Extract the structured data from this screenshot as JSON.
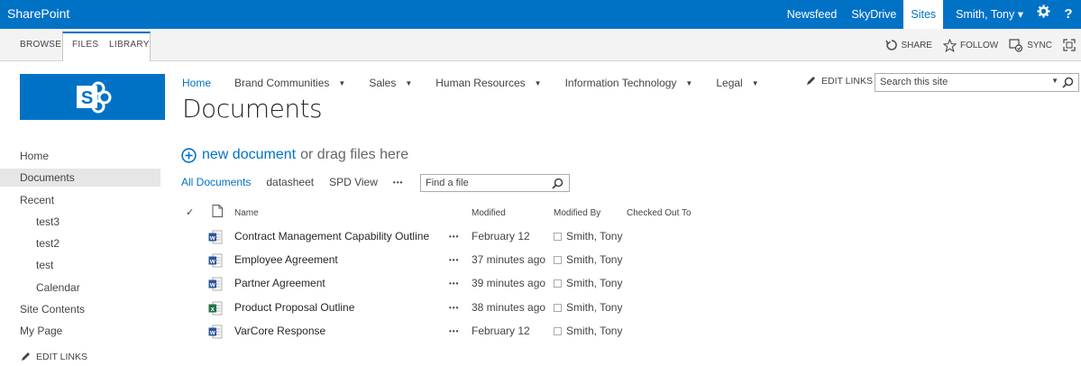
{
  "suite": {
    "brand": "SharePoint",
    "links": [
      "Newsfeed",
      "SkyDrive",
      "Sites"
    ],
    "active_link": "Sites",
    "user": "Smith, Tony ▾",
    "icons": [
      "gear-icon",
      "help-icon"
    ],
    "help_glyph": "?"
  },
  "ribbon": {
    "tabs": [
      "BROWSE",
      "FILES",
      "LIBRARY"
    ],
    "actions": {
      "share": "SHARE",
      "follow": "FOLLOW",
      "sync": "SYNC"
    }
  },
  "site": {
    "logo_letter": "S",
    "topnav": [
      {
        "label": "Home",
        "current": true
      },
      {
        "label": "Brand Communities",
        "dropdown": true
      },
      {
        "label": "Sales",
        "dropdown": true
      },
      {
        "label": "Human Resources",
        "dropdown": true
      },
      {
        "label": "Information Technology",
        "dropdown": true
      },
      {
        "label": "Legal",
        "dropdown": true
      }
    ],
    "edit_links": "EDIT LINKS",
    "search_placeholder": "Search this site",
    "page_title": "Documents"
  },
  "leftnav": {
    "items": [
      "Home",
      "Documents",
      "Recent",
      "test3",
      "test2",
      "test",
      "Calendar",
      "Site Contents",
      "My Page"
    ],
    "selected": "Documents",
    "edit_links": "EDIT LINKS"
  },
  "library": {
    "new_document": "new document",
    "drag_text": "or drag files here",
    "views": [
      "All Documents",
      "datasheet",
      "SPD View"
    ],
    "current_view": "All Documents",
    "more": "•••",
    "find_placeholder": "Find a file",
    "columns": {
      "name": "Name",
      "modified": "Modified",
      "modified_by": "Modified By",
      "checked_out_to": "Checked Out To"
    },
    "check_glyph": "✓",
    "rows": [
      {
        "type": "word",
        "name": "Contract Management Capability Outline",
        "modified": "February 12",
        "modified_by": "Smith, Tony"
      },
      {
        "type": "word",
        "name": "Employee Agreement",
        "modified": "37 minutes ago",
        "modified_by": "Smith, Tony"
      },
      {
        "type": "word",
        "name": "Partner Agreement",
        "modified": "39 minutes ago",
        "modified_by": "Smith, Tony"
      },
      {
        "type": "excel",
        "name": "Product Proposal Outline",
        "modified": "38 minutes ago",
        "modified_by": "Smith, Tony"
      },
      {
        "type": "word",
        "name": "VarCore Response",
        "modified": "February 12",
        "modified_by": "Smith, Tony"
      }
    ]
  },
  "colors": {
    "brand_blue": "#0072c6",
    "word_blue": "#2b579a",
    "excel_green": "#217346"
  }
}
